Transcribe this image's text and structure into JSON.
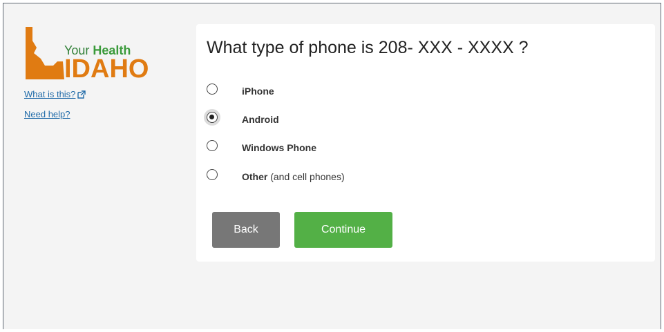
{
  "logo": {
    "your": "Your",
    "health": "Health",
    "state": "IDAHO"
  },
  "sidebar": {
    "what_is_this": "What is this?",
    "need_help": "Need help?"
  },
  "question": "What type of phone is 208- XXX - XXXX ?",
  "options": [
    {
      "label": "iPhone",
      "note": "",
      "checked": false
    },
    {
      "label": "Android",
      "note": "",
      "checked": true
    },
    {
      "label": "Windows Phone",
      "note": "",
      "checked": false
    },
    {
      "label": "Other",
      "note": "(and cell phones)",
      "checked": false
    }
  ],
  "buttons": {
    "back": "Back",
    "continue": "Continue"
  },
  "colors": {
    "accent_green": "#53b046",
    "logo_orange": "#e07b12",
    "link_blue": "#1f6aa8"
  }
}
